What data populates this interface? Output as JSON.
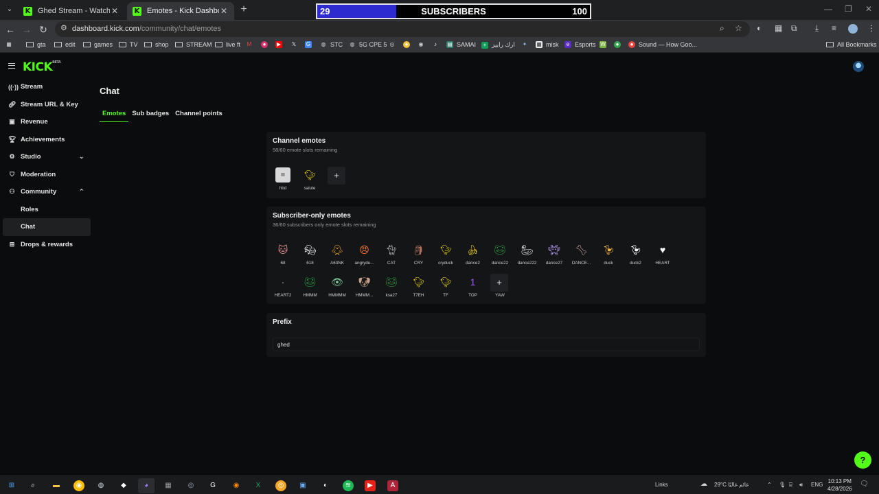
{
  "browser": {
    "tabs": [
      {
        "title": "Ghed Stream - Watch Live on K",
        "active": false
      },
      {
        "title": "Emotes - Kick Dashboard",
        "active": true
      }
    ],
    "url_domain": "dashboard.kick.com",
    "url_path": "/community/chat/emotes",
    "bookmarks": [
      "gta",
      "edit",
      "games",
      "TV",
      "shop",
      "STREAM",
      "live ft",
      "STC",
      "5G CPE 5",
      "SAMAI",
      "ارك رابيز",
      "misk",
      "Esports",
      "Sound — How Goo..."
    ],
    "all_bookmarks": "All Bookmarks"
  },
  "sub_goal": {
    "current": "29",
    "label": "SUBSCRIBERS",
    "target": "100",
    "progress": 0.29,
    "fill_color": "#2d2bd0"
  },
  "app": {
    "logo": "KICK",
    "logo_mark": "BETA",
    "accent": "#53fc18"
  },
  "sidebar": {
    "items": [
      {
        "label": "Stream",
        "icon": "broadcast-icon"
      },
      {
        "label": "Stream URL & Key",
        "icon": "link-icon"
      },
      {
        "label": "Revenue",
        "icon": "wallet-icon"
      },
      {
        "label": "Achievements",
        "icon": "trophy-icon"
      },
      {
        "label": "Studio",
        "icon": "studio-icon"
      },
      {
        "label": "Moderation",
        "icon": "shield-icon"
      },
      {
        "label": "Community",
        "icon": "people-icon"
      },
      {
        "label": "Roles"
      },
      {
        "label": "Chat"
      },
      {
        "label": "Drops & rewards",
        "icon": "gift-icon"
      }
    ]
  },
  "page": {
    "title": "Chat",
    "tabs": [
      "Emotes",
      "Sub badges",
      "Channel points"
    ]
  },
  "channel_emotes": {
    "title": "Channel emotes",
    "subtitle": "58/60 emote slots remaining",
    "emotes": [
      "hbd",
      "salute"
    ]
  },
  "subscriber_emotes": {
    "title": "Subscriber-only emotes",
    "subtitle": "36/60 subscribers only emote slots remaining",
    "emotes": [
      "68",
      "618",
      "A63NK",
      "angrydu...",
      "CAT",
      "CRY",
      "cryduck",
      "dance2",
      "dance22",
      "dance222",
      "dance27",
      "DANCE...",
      "duck",
      "duck2",
      "HEART",
      "HEART2",
      "HMMM",
      "HMMMM",
      "HMMM...",
      "ksa27",
      "T7EH",
      "TF",
      "TOP",
      "YAW"
    ]
  },
  "prefix": {
    "title": "Prefix",
    "value": "ghed"
  },
  "taskbar": {
    "links": "Links",
    "weather": "29°C غائم غالبًا",
    "lang": "ENG",
    "time": "10:13 PM",
    "date": "4/28/2026"
  }
}
